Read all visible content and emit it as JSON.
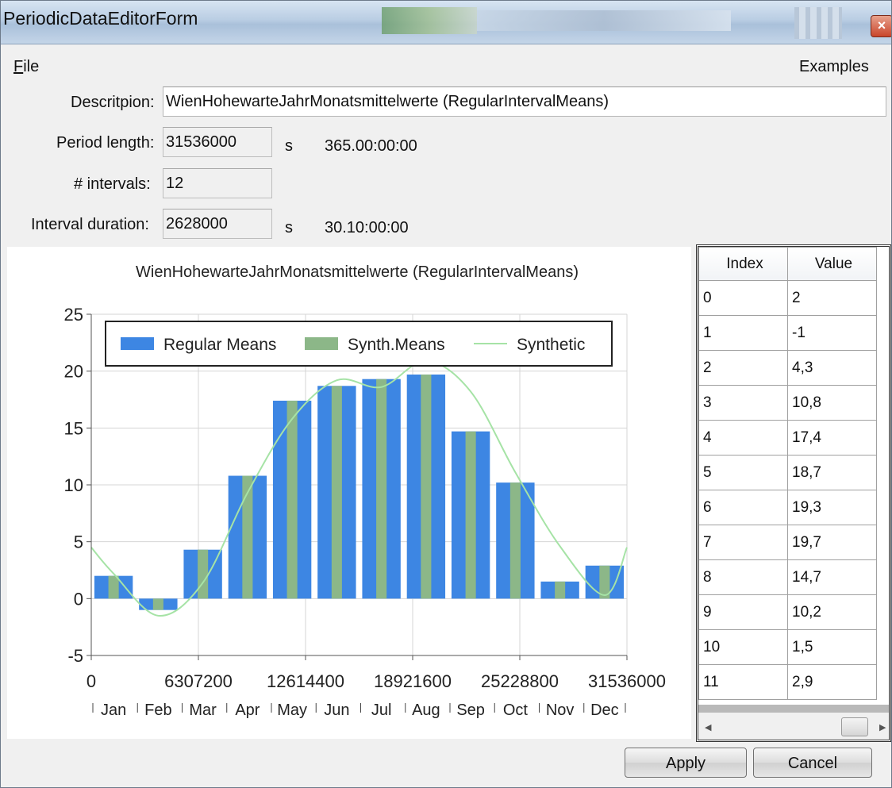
{
  "window": {
    "title": "PeriodicDataEditorForm",
    "close_glyph": "×"
  },
  "menu": {
    "file_first": "F",
    "file_rest": "ile",
    "examples": "Examples"
  },
  "form": {
    "description_label": "Descritpion:",
    "description_value": "WienHohewarteJahrMonatsmittelwerte (RegularIntervalMeans)",
    "period_length_label": "Period length:",
    "period_length_value": "31536000",
    "period_length_unit": "s",
    "period_length_readable": "365.00:00:00",
    "intervals_label": "# intervals:",
    "intervals_value": "12",
    "interval_duration_label": "Interval duration:",
    "interval_duration_value": "2628000",
    "interval_duration_unit": "s",
    "interval_duration_readable": "30.10:00:00"
  },
  "chart_data": {
    "type": "bar",
    "title": "WienHohewarteJahrMonatsmittelwerte (RegularIntervalMeans)",
    "xlabel": "",
    "ylabel": "",
    "xlim": [
      0,
      31536000
    ],
    "ylim": [
      -5,
      25
    ],
    "x_ticks": [
      0,
      6307200,
      12614400,
      18921600,
      25228800,
      31536000
    ],
    "x_tick_labels": [
      "0",
      "6307200",
      "12614400",
      "18921600",
      "25228800",
      "31536000"
    ],
    "y_ticks": [
      -5,
      0,
      5,
      10,
      15,
      20,
      25
    ],
    "y_tick_labels": [
      "-5",
      "0",
      "5",
      "10",
      "15",
      "20",
      "25"
    ],
    "categories": [
      "Jan",
      "Feb",
      "Mar",
      "Apr",
      "May",
      "Jun",
      "Jul",
      "Aug",
      "Sep",
      "Oct",
      "Nov",
      "Dec"
    ],
    "grid": true,
    "legend_position": "top",
    "series": [
      {
        "name": "Regular Means",
        "type": "bar",
        "color": "#3d86e3",
        "values": [
          2,
          -1,
          4.3,
          10.8,
          17.4,
          18.7,
          19.3,
          19.7,
          14.7,
          10.2,
          1.5,
          2.9
        ]
      },
      {
        "name": "Synth.Means",
        "type": "bar",
        "color": "#8cb788",
        "values": [
          2,
          -1,
          4.3,
          10.8,
          17.4,
          18.7,
          19.3,
          19.7,
          14.7,
          10.2,
          1.5,
          2.9
        ]
      },
      {
        "name": "Synthetic",
        "type": "line",
        "color": "#a6e3a6",
        "x": [
          0,
          1314000,
          3942000,
          6570000,
          9198000,
          11826000,
          14454000,
          17082000,
          19710000,
          22338000,
          24966000,
          27594000,
          30222000,
          31536000
        ],
        "y": [
          4.5,
          2.2,
          -1.5,
          1.4,
          9.3,
          15.8,
          19.2,
          18.6,
          20.9,
          18.2,
          11.1,
          4.6,
          0.3,
          4.5
        ]
      }
    ]
  },
  "table": {
    "headers": [
      "Index",
      "Value"
    ],
    "rows": [
      [
        "0",
        "2"
      ],
      [
        "1",
        "-1"
      ],
      [
        "2",
        "4,3"
      ],
      [
        "3",
        "10,8"
      ],
      [
        "4",
        "17,4"
      ],
      [
        "5",
        "18,7"
      ],
      [
        "6",
        "19,3"
      ],
      [
        "7",
        "19,7"
      ],
      [
        "8",
        "14,7"
      ],
      [
        "9",
        "10,2"
      ],
      [
        "10",
        "1,5"
      ],
      [
        "11",
        "2,9"
      ]
    ]
  },
  "buttons": {
    "apply": "Apply",
    "cancel": "Cancel"
  }
}
